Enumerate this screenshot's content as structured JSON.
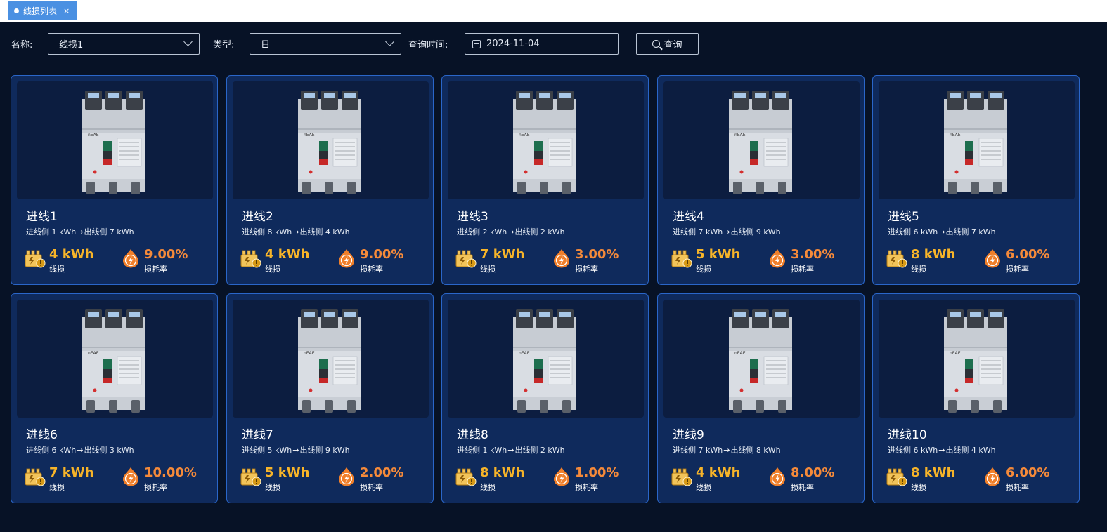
{
  "tabs": [
    {
      "label": "线损列表",
      "close": "×"
    }
  ],
  "filters": {
    "name_label": "名称:",
    "name_value": "线损1",
    "type_label": "类型:",
    "type_value": "日",
    "time_label": "查询时间:",
    "time_value": "2024-11-04",
    "query_button": "查询"
  },
  "labels": {
    "loss": "线损",
    "rate": "损耗率"
  },
  "cards": [
    {
      "title": "进线1",
      "in": "进线侧 1 kWh",
      "out": "出线侧 7 kWh",
      "loss": "4 kWh",
      "rate": "9.00%"
    },
    {
      "title": "进线2",
      "in": "进线侧 8 kWh",
      "out": "出线侧 4 kWh",
      "loss": "4 kWh",
      "rate": "9.00%"
    },
    {
      "title": "进线3",
      "in": "进线侧 2 kWh",
      "out": "出线侧 2 kWh",
      "loss": "7 kWh",
      "rate": "3.00%"
    },
    {
      "title": "进线4",
      "in": "进线侧 7 kWh",
      "out": "出线侧 9 kWh",
      "loss": "5 kWh",
      "rate": "3.00%"
    },
    {
      "title": "进线5",
      "in": "进线侧 6 kWh",
      "out": "出线侧 7 kWh",
      "loss": "8 kWh",
      "rate": "6.00%"
    },
    {
      "title": "进线6",
      "in": "进线侧 6 kWh",
      "out": "出线侧 3 kWh",
      "loss": "7 kWh",
      "rate": "10.00%"
    },
    {
      "title": "进线7",
      "in": "进线侧 5 kWh",
      "out": "出线侧 9 kWh",
      "loss": "5 kWh",
      "rate": "2.00%"
    },
    {
      "title": "进线8",
      "in": "进线侧 1 kWh",
      "out": "出线侧 2 kWh",
      "loss": "8 kWh",
      "rate": "1.00%"
    },
    {
      "title": "进线9",
      "in": "进线侧 7 kWh",
      "out": "出线侧 8 kWh",
      "loss": "4 kWh",
      "rate": "8.00%"
    },
    {
      "title": "进线10",
      "in": "进线侧 6 kWh",
      "out": "出线侧 4 kWh",
      "loss": "8 kWh",
      "rate": "6.00%"
    }
  ],
  "icons": {
    "breaker": "circuit-breaker-image",
    "loss": "meter-warning-icon",
    "rate": "lightning-drop-icon",
    "arrow": "arrow-right-icon"
  },
  "colors": {
    "loss_value": "#f7b429",
    "rate_value": "#f58a3a",
    "card_border": "#2a66c9",
    "tab_active": "#4a90e2"
  }
}
